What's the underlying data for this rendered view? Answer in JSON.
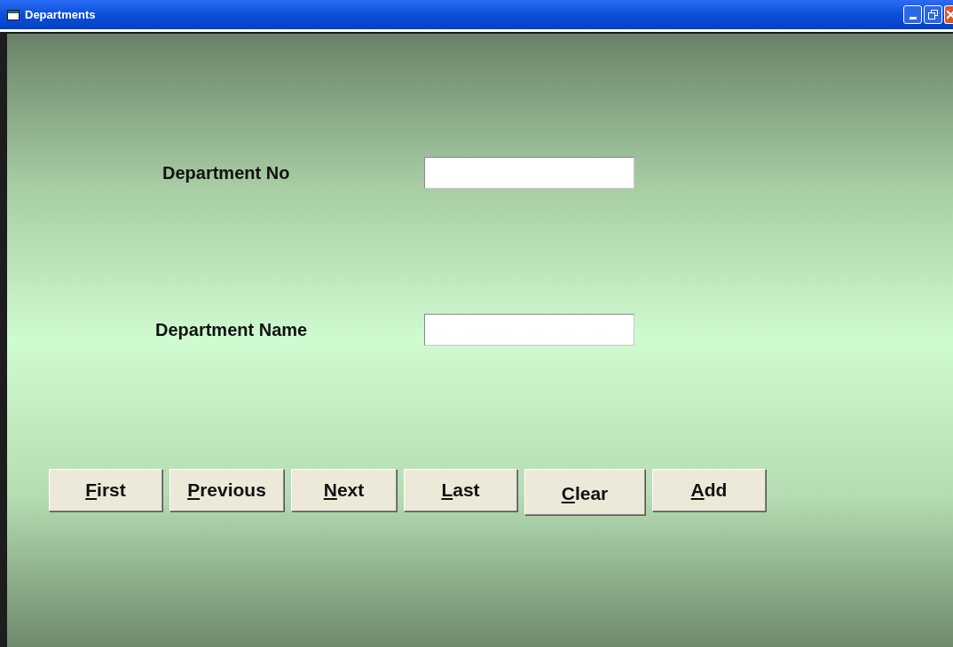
{
  "window": {
    "title": "Departments"
  },
  "fields": [
    {
      "label": "Department No"
    },
    {
      "label": "Department Name"
    }
  ],
  "buttons": [
    {
      "mnemonic": "F",
      "rest": "irst"
    },
    {
      "mnemonic": "P",
      "rest": "revious"
    },
    {
      "mnemonic": "N",
      "rest": "ext"
    },
    {
      "mnemonic": "L",
      "rest": "ast"
    },
    {
      "mnemonic": "C",
      "rest": "lear"
    },
    {
      "mnemonic": "A",
      "rest": "dd"
    }
  ]
}
